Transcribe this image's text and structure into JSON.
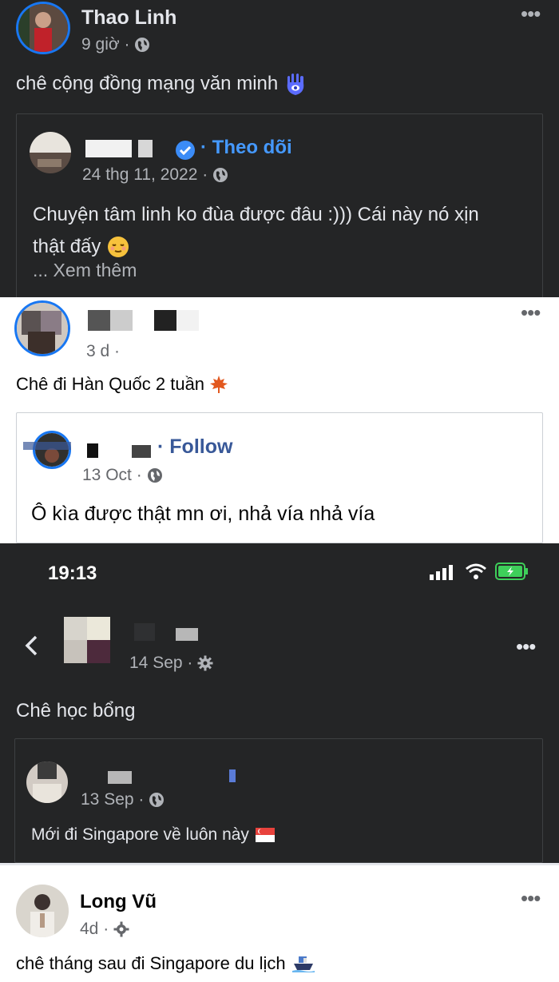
{
  "post1": {
    "author": "Thao Linh",
    "time": "9 giờ ·",
    "text": "chê cộng đồng mạng văn minh",
    "shared": {
      "follow": "· Theo dõi",
      "time": "24 thg 11, 2022 ·",
      "text_line1": "Chuyện tâm linh ko đùa được đâu :))) Cái này nó xịn",
      "text_line2": "thật đấy",
      "see_more": "... Xem thêm"
    }
  },
  "post2": {
    "time": "3 d ·",
    "text": "Chê đi Hàn Quốc 2 tuần",
    "shared": {
      "follow": "· Follow",
      "time": "13 Oct ·",
      "text": "Ô kìa được thật mn ơi, nhả vía nhả vía"
    }
  },
  "post3": {
    "status_time": "19:13",
    "time": "14 Sep ·",
    "text": "Chê học bổng",
    "shared": {
      "time": "13 Sep ·",
      "text": "Mới đi Singapore về luôn này"
    }
  },
  "post4": {
    "author": "Long Vũ",
    "time": "4d ·",
    "text": "chê tháng sau đi Singapore du lịch"
  },
  "icons": {
    "hamsa": "hamsa-emoji",
    "maple": "maple-leaf-emoji",
    "flag": "singapore-flag-emoji",
    "ship": "ship-emoji",
    "relieved": "relieved-face-emoji"
  },
  "colors": {
    "dark_bg": "#242526",
    "link_blue": "#4599ff",
    "follow_blue": "#385898",
    "verified": "#3b8cf7"
  }
}
